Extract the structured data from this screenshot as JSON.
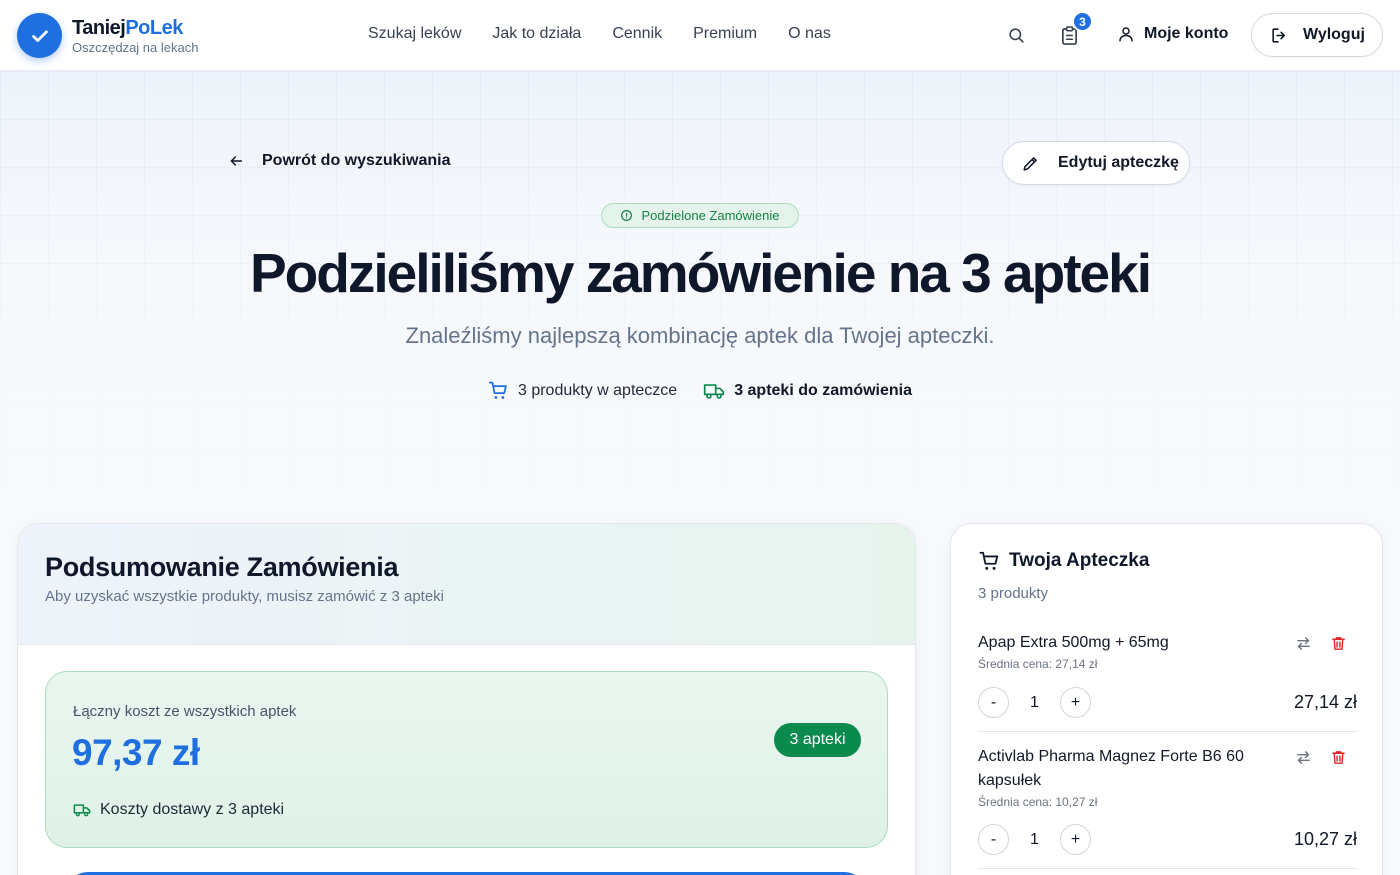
{
  "brand": {
    "name_part1": "Taniej",
    "name_part2": "PoLek",
    "tagline": "Oszczędzaj na lekach"
  },
  "nav": [
    {
      "label": "Szukaj leków"
    },
    {
      "label": "Jak to działa"
    },
    {
      "label": "Cennik"
    },
    {
      "label": "Premium"
    },
    {
      "label": "O nas"
    }
  ],
  "header": {
    "cart_count": "3",
    "account_label": "Moje konto",
    "logout_label": "Wyloguj"
  },
  "hero": {
    "back_label": "Powrót do wyszukiwania",
    "edit_label": "Edytuj apteczkę",
    "badge": "Podzielone Zamówienie",
    "title": "Podzieliliśmy zamówienie na 3 apteki",
    "subtitle": "Znaleźliśmy najlepszą kombinację aptek dla Twojej apteczki.",
    "stat_products": "3 produkty w apteczce",
    "stat_pharmacies": "3 apteki do zamówienia"
  },
  "summary": {
    "title": "Podsumowanie Zamówienia",
    "subtitle": "Aby uzyskać wszystkie produkty, musisz zamówić z 3 apteki",
    "total_label": "Łączny koszt ze wszystkich aptek",
    "total_amount": "97,37 zł",
    "pharmacies_badge": "3 apteki",
    "delivery_note": "Koszty dostawy z 3 apteki"
  },
  "kit": {
    "title": "Twoja Apteczka",
    "count": "3 produkty",
    "items": [
      {
        "name": "Apap Extra 500mg + 65mg",
        "avg": "Średnia cena: 27,14 zł",
        "qty": "1",
        "price": "27,14 zł"
      },
      {
        "name": "Activlab Pharma Magnez Forte B6 60 kapsułek",
        "avg": "Średnia cena: 10,27 zł",
        "qty": "1",
        "price": "10,27 zł"
      }
    ],
    "minus": "-",
    "plus": "+"
  },
  "colors": {
    "accent": "#1f6fe0",
    "success": "#0b8a4e",
    "danger": "#dc2626"
  }
}
